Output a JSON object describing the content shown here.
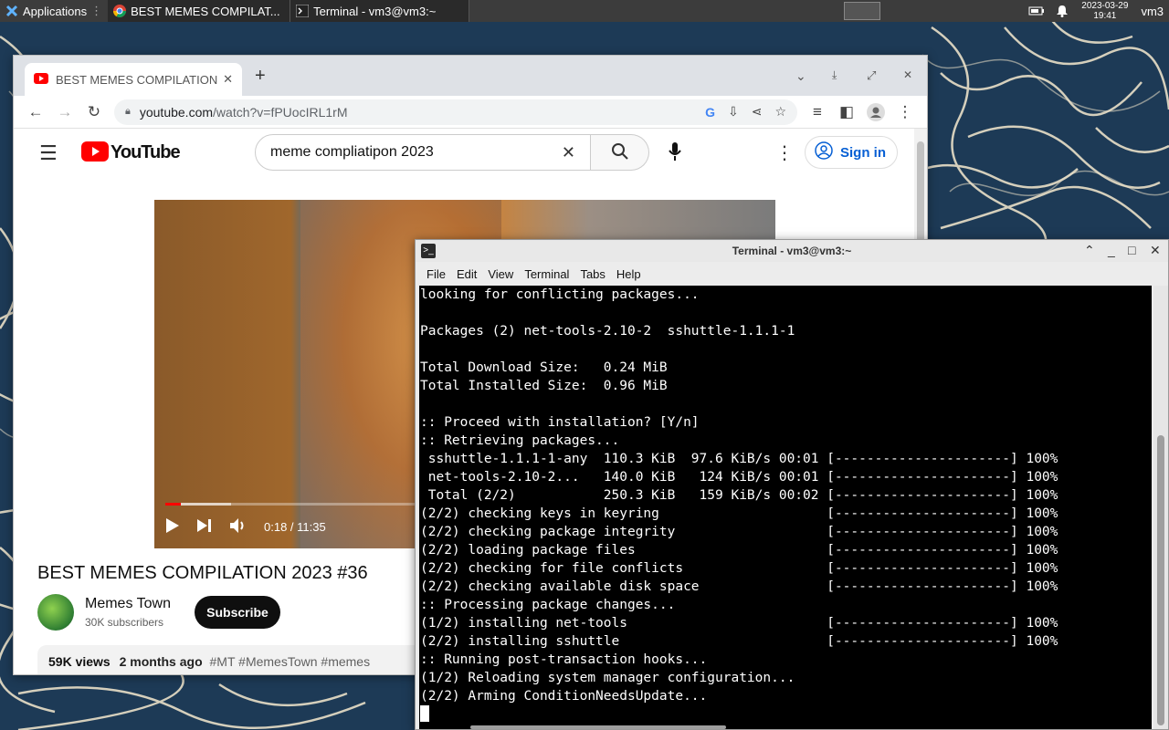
{
  "desktop": {
    "bg_color": "#1d3a56",
    "pattern_color": "#e9e0c8"
  },
  "top_panel": {
    "applications_label": "Applications",
    "tasks": [
      {
        "label": "BEST MEMES COMPILAT...",
        "icon": "chrome-icon"
      },
      {
        "label": "Terminal - vm3@vm3:~",
        "icon": "terminal-icon"
      }
    ],
    "clock_date": "2023-03-29",
    "clock_time": "19:41",
    "user": "vm3"
  },
  "chrome": {
    "tab_title": "BEST MEMES COMPILATION",
    "url_host": "youtube.com",
    "url_path": "/watch?v=fPUocIRL1rM"
  },
  "youtube": {
    "logo_text": "YouTube",
    "search_query": "meme compliatipon 2023",
    "signin_label": "Sign in",
    "video_time": "0:18 / 11:35",
    "progress_played_fraction": 0.026,
    "progress_buffered_fraction": 0.11,
    "video_title": "BEST MEMES COMPILATION 2023 #36",
    "channel_name": "Memes Town",
    "channel_subs": "30K subscribers",
    "subscribe_label": "Subscribe",
    "views": "59K views",
    "posted": "2 months ago",
    "tags": "#MT #MemesTown #memes"
  },
  "terminal": {
    "title": "Terminal - vm3@vm3:~",
    "menus": [
      "File",
      "Edit",
      "View",
      "Terminal",
      "Tabs",
      "Help"
    ],
    "lines": [
      "looking for conflicting packages...",
      "",
      "Packages (2) net-tools-2.10-2  sshuttle-1.1.1-1",
      "",
      "Total Download Size:   0.24 MiB",
      "Total Installed Size:  0.96 MiB",
      "",
      ":: Proceed with installation? [Y/n]",
      ":: Retrieving packages...",
      " sshuttle-1.1.1-1-any  110.3 KiB  97.6 KiB/s 00:01 [----------------------] 100%",
      " net-tools-2.10-2...   140.0 KiB   124 KiB/s 00:01 [----------------------] 100%",
      " Total (2/2)           250.3 KiB   159 KiB/s 00:02 [----------------------] 100%",
      "(2/2) checking keys in keyring                     [----------------------] 100%",
      "(2/2) checking package integrity                   [----------------------] 100%",
      "(2/2) loading package files                        [----------------------] 100%",
      "(2/2) checking for file conflicts                  [----------------------] 100%",
      "(2/2) checking available disk space                [----------------------] 100%",
      ":: Processing package changes...",
      "(1/2) installing net-tools                         [----------------------] 100%",
      "(2/2) installing sshuttle                          [----------------------] 100%",
      ":: Running post-transaction hooks...",
      "(1/2) Reloading system manager configuration...",
      "(2/2) Arming ConditionNeedsUpdate..."
    ]
  }
}
